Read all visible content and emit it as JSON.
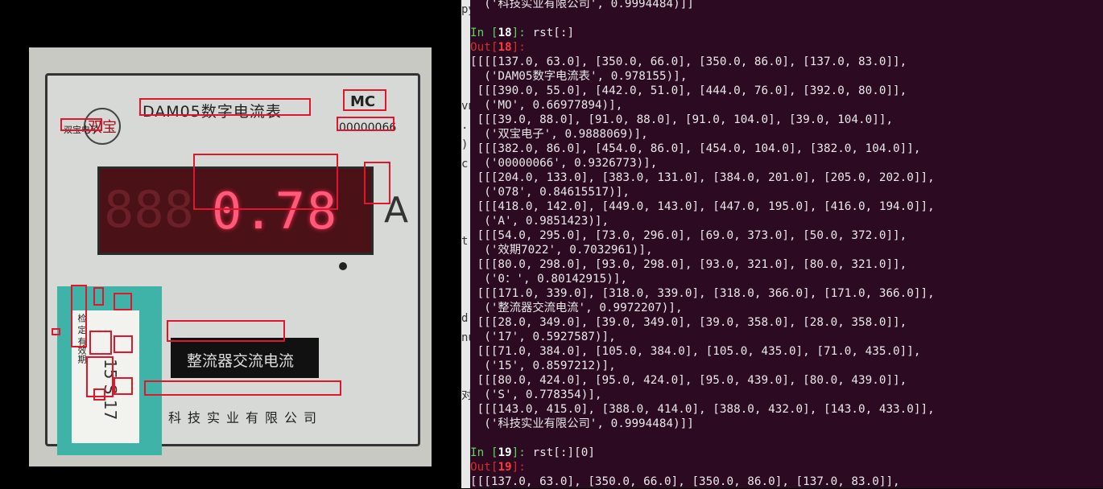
{
  "viewer": {
    "meter": {
      "brand_logo_text": "双宝",
      "title": "DAM05数字电流表",
      "mc_mark": "MC",
      "company_short": "双宝电子",
      "serial": "00000066",
      "display_ghost": "888",
      "display_value": "0.78",
      "unit": "A",
      "black_panel_text": "整流器交流电流",
      "bottom_text": "科技实业有限公司",
      "sticker_text": "检 定 有效期",
      "sticker_handwriting": "15 S 17"
    }
  },
  "terminal": {
    "lines": [
      {
        "type": "text",
        "text": "  ('科技实业有限公司', 0.9994484)]]"
      },
      {
        "type": "text",
        "text": ""
      },
      {
        "type": "in",
        "n": "18",
        "code": "rst[:]"
      },
      {
        "type": "out",
        "n": "18"
      },
      {
        "type": "text",
        "text": "[[[[137.0, 63.0], [350.0, 66.0], [350.0, 86.0], [137.0, 83.0]],"
      },
      {
        "type": "text",
        "text": "  ('DAM05数字电流表', 0.978155)],"
      },
      {
        "type": "text",
        "text": " [[[390.0, 55.0], [442.0, 51.0], [444.0, 76.0], [392.0, 80.0]],"
      },
      {
        "type": "text",
        "text": "  ('MO', 0.66977894)],"
      },
      {
        "type": "text",
        "text": " [[[39.0, 88.0], [91.0, 88.0], [91.0, 104.0], [39.0, 104.0]],"
      },
      {
        "type": "text",
        "text": "  ('双宝电子', 0.9888069)],"
      },
      {
        "type": "text",
        "text": " [[[382.0, 86.0], [454.0, 86.0], [454.0, 104.0], [382.0, 104.0]],"
      },
      {
        "type": "text",
        "text": "  ('00000066', 0.9326773)],"
      },
      {
        "type": "text",
        "text": " [[[204.0, 133.0], [383.0, 131.0], [384.0, 201.0], [205.0, 202.0]],"
      },
      {
        "type": "text",
        "text": "  ('078', 0.84615517)],"
      },
      {
        "type": "text",
        "text": " [[[418.0, 142.0], [449.0, 143.0], [447.0, 195.0], [416.0, 194.0]],"
      },
      {
        "type": "text",
        "text": "  ('A', 0.9851423)],"
      },
      {
        "type": "text",
        "text": " [[[54.0, 295.0], [73.0, 296.0], [69.0, 373.0], [50.0, 372.0]],"
      },
      {
        "type": "text",
        "text": "  ('效期7022', 0.7032961)],"
      },
      {
        "type": "text",
        "text": " [[[80.0, 298.0], [93.0, 298.0], [93.0, 321.0], [80.0, 321.0]],"
      },
      {
        "type": "text",
        "text": "  ('0：', 0.80142915)],"
      },
      {
        "type": "text",
        "text": " [[[171.0, 339.0], [318.0, 339.0], [318.0, 366.0], [171.0, 366.0]],"
      },
      {
        "type": "text",
        "text": "  ('整流器交流电流', 0.9972207)],"
      },
      {
        "type": "text",
        "text": " [[[28.0, 349.0], [39.0, 349.0], [39.0, 358.0], [28.0, 358.0]],"
      },
      {
        "type": "text",
        "text": "  ('17', 0.5927587)],"
      },
      {
        "type": "text",
        "text": " [[[71.0, 384.0], [105.0, 384.0], [105.0, 435.0], [71.0, 435.0]],"
      },
      {
        "type": "text",
        "text": "  ('15', 0.8597212)],"
      },
      {
        "type": "text",
        "text": " [[[80.0, 424.0], [95.0, 424.0], [95.0, 439.0], [80.0, 439.0]],"
      },
      {
        "type": "text",
        "text": "  ('S', 0.778354)],"
      },
      {
        "type": "text",
        "text": " [[[143.0, 415.0], [388.0, 414.0], [388.0, 432.0], [143.0, 433.0]],"
      },
      {
        "type": "text",
        "text": "  ('科技实业有限公司', 0.9994484)]]"
      },
      {
        "type": "text",
        "text": ""
      },
      {
        "type": "in",
        "n": "19",
        "code": "rst[:][0]"
      },
      {
        "type": "out",
        "n": "19"
      },
      {
        "type": "text",
        "text": "[[[137.0, 63.0], [350.0, 66.0], [350.0, 86.0], [137.0, 83.0]],"
      }
    ],
    "gutter_fragments": [
      "py",
      "",
      "",
      "",
      "",
      "vn",
      ".",
      ")",
      "c",
      "",
      "",
      "",
      "t",
      "",
      "",
      "",
      "d",
      "nu",
      "",
      "",
      "对"
    ]
  },
  "colors": {
    "terminal_bg": "#2c0a22",
    "prompt_in": "#5fd35f",
    "prompt_out": "#d62b2b",
    "ocr_box": "#e0162c",
    "led": "#ff5a7a"
  }
}
